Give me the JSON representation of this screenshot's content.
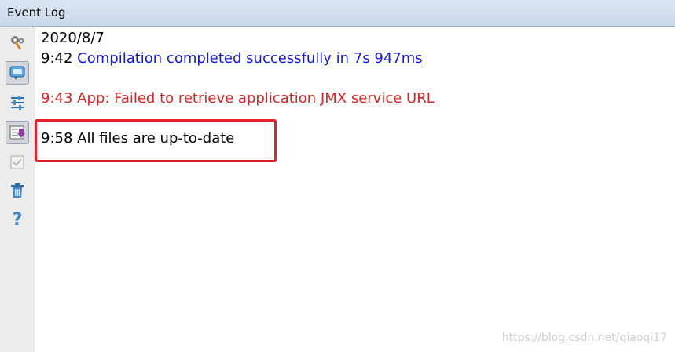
{
  "window": {
    "title": "Event Log"
  },
  "toolbar": {
    "tools": [
      {
        "icon": "wrench-settings-icon"
      },
      {
        "icon": "balloon-message-icon",
        "selected": true
      },
      {
        "icon": "filter-settings-icon"
      },
      {
        "icon": "scroll-to-end-icon",
        "selected": true
      },
      {
        "icon": "mark-all-read-icon"
      },
      {
        "icon": "trash-icon"
      },
      {
        "icon": "help-icon"
      }
    ]
  },
  "log": {
    "date": "2020/8/7",
    "entries": [
      {
        "time": "9:42",
        "message": "Compilation completed successfully in 7s 947ms",
        "kind": "link"
      },
      {
        "time": "9:43",
        "message": "App: Failed to retrieve application JMX service URL",
        "kind": "error"
      },
      {
        "time": "9:58",
        "message": "All files are up-to-date",
        "kind": "normal"
      }
    ]
  },
  "watermark": "https://blog.csdn.net/qiaoqi17",
  "colors": {
    "link": "#1515e6",
    "error": "#e02020",
    "highlight_box": "#e8202a"
  }
}
